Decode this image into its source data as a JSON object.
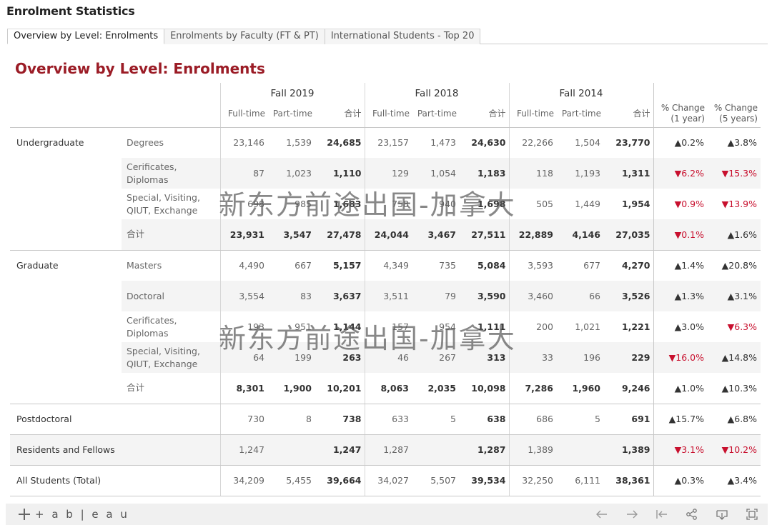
{
  "app_title": "Enrolment Statistics",
  "tabs": [
    {
      "label": "Overview by Level: Enrolments",
      "active": true
    },
    {
      "label": "Enrolments by Faculty (FT & PT)",
      "active": false
    },
    {
      "label": "International Students - Top 20",
      "active": false
    }
  ],
  "section_title": "Overview by Level: Enrolments",
  "table": {
    "years": [
      "Fall 2019",
      "Fall 2018",
      "Fall 2014"
    ],
    "sub_headers": {
      "full_time": "Full-time",
      "part_time": "Part-time",
      "total": "合计"
    },
    "pct_headers": {
      "one_year": [
        "% Change",
        "(1 year)"
      ],
      "five_year": [
        "% Change",
        "(5 years)"
      ]
    },
    "rows": [
      {
        "level": "Undergraduate",
        "category": "Degrees",
        "v": [
          "23,146",
          "1,539",
          "24,685",
          "23,157",
          "1,473",
          "24,630",
          "22,266",
          "1,504",
          "23,770"
        ],
        "p1": "▲0.2%",
        "p5": "▲3.8%"
      },
      {
        "level": "",
        "category": "Cerificates, Diplomas",
        "v": [
          "87",
          "1,023",
          "1,110",
          "129",
          "1,054",
          "1,183",
          "118",
          "1,193",
          "1,311"
        ],
        "p1": "▼6.2%",
        "p5": "▼15.3%"
      },
      {
        "level": "",
        "category": "Special, Visiting, QIUT, Exchange",
        "v": [
          "698",
          "985",
          "1,683",
          "758",
          "940",
          "1,698",
          "505",
          "1,449",
          "1,954"
        ],
        "p1": "▼0.9%",
        "p5": "▼13.9%"
      },
      {
        "level": "",
        "category": "合计",
        "v": [
          "23,931",
          "3,547",
          "27,478",
          "24,044",
          "3,467",
          "27,511",
          "22,889",
          "4,146",
          "27,035"
        ],
        "p1": "▼0.1%",
        "p5": "▲1.6%"
      },
      {
        "level": "Graduate",
        "category": "Masters",
        "v": [
          "4,490",
          "667",
          "5,157",
          "4,349",
          "735",
          "5,084",
          "3,593",
          "677",
          "4,270"
        ],
        "p1": "▲1.4%",
        "p5": "▲20.8%"
      },
      {
        "level": "",
        "category": "Doctoral",
        "v": [
          "3,554",
          "83",
          "3,637",
          "3,511",
          "79",
          "3,590",
          "3,460",
          "66",
          "3,526"
        ],
        "p1": "▲1.3%",
        "p5": "▲3.1%"
      },
      {
        "level": "",
        "category": "Cerificates, Diplomas",
        "v": [
          "193",
          "951",
          "1,144",
          "157",
          "954",
          "1,111",
          "200",
          "1,021",
          "1,221"
        ],
        "p1": "▲3.0%",
        "p5": "▼6.3%"
      },
      {
        "level": "",
        "category": "Special, Visiting, QIUT, Exchange",
        "v": [
          "64",
          "199",
          "263",
          "46",
          "267",
          "313",
          "33",
          "196",
          "229"
        ],
        "p1": "▼16.0%",
        "p5": "▲14.8%"
      },
      {
        "level": "",
        "category": "合计",
        "v": [
          "8,301",
          "1,900",
          "10,201",
          "8,063",
          "2,035",
          "10,098",
          "7,286",
          "1,960",
          "9,246"
        ],
        "p1": "▲1.0%",
        "p5": "▲10.3%"
      },
      {
        "level": "Postdoctoral",
        "category": "",
        "v": [
          "730",
          "8",
          "738",
          "633",
          "5",
          "638",
          "686",
          "5",
          "691"
        ],
        "p1": "▲15.7%",
        "p5": "▲6.8%"
      },
      {
        "level": "Residents and Fellows",
        "category": "",
        "v": [
          "1,247",
          "",
          "1,247",
          "1,287",
          "",
          "1,287",
          "1,389",
          "",
          "1,389"
        ],
        "p1": "▼3.1%",
        "p5": "▼10.2%"
      },
      {
        "level": "All Students (Total)",
        "category": "",
        "v": [
          "34,209",
          "5,455",
          "39,664",
          "34,027",
          "5,507",
          "39,534",
          "32,250",
          "6,111",
          "38,361"
        ],
        "p1": "▲0.3%",
        "p5": "▲3.4%"
      }
    ]
  },
  "watermark": "新东方前途出国-加拿大",
  "footer": {
    "logo_text": "+ a b | e a u",
    "icons": [
      "undo-icon",
      "redo-icon",
      "revert-icon",
      "share-icon",
      "download-icon",
      "fullscreen-icon"
    ]
  },
  "colors": {
    "title_red": "#9b1c26",
    "negative": "#c8102e",
    "shade": "#f4f4f4"
  }
}
